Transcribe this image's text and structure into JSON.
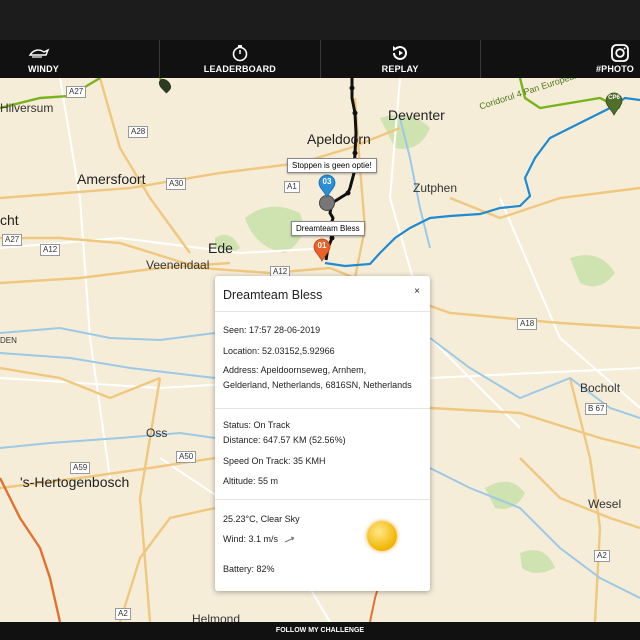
{
  "nav": {
    "items": [
      {
        "label": "WINDY",
        "icon": "windy-icon"
      },
      {
        "label": "LEADERBOARD",
        "icon": "stopwatch-icon"
      },
      {
        "label": "REPLAY",
        "icon": "replay-icon"
      },
      {
        "label": "#PHOTO",
        "icon": "instagram-icon"
      }
    ]
  },
  "map": {
    "places": {
      "hilversum": "Hilversum",
      "apeldoorn": "Apeldoorn",
      "deventer": "Deventer",
      "amersfoort": "Amersfoort",
      "zutphen": "Zutphen",
      "ede": "Ede",
      "veenendaal": "Veenendaal",
      "oss": "Oss",
      "hertogenbosch": "'s-Hertogenbosch",
      "bocholt": "Bocholt",
      "wesel": "Wesel",
      "helmond": "Helmond",
      "utrecht_fragment": "cht",
      "den_fragment": "DEN"
    },
    "roads": [
      "A27",
      "A28",
      "A1",
      "A30",
      "A12",
      "A27",
      "A12",
      "A18",
      "A50",
      "A2",
      "A59",
      "B 67",
      "A2"
    ],
    "route_label": "Coridorul 4 Pan European",
    "tooltips": {
      "stop": "Stoppen is geen optie!",
      "team": "Dreamteam Bless"
    },
    "pins": {
      "blue": "03",
      "orange": "01",
      "green": "CP6"
    }
  },
  "popup": {
    "title": "Dreamteam Bless",
    "close": "×",
    "seen": "Seen: 17:57 28-06-2019",
    "location": "Location: 52.03152,5.92966",
    "address_line1": "Address: Apeldoornseweg, Arnhem,",
    "address_line2": "Gelderland, Netherlands, 6816SN, Netherlands",
    "status": "Status: On Track",
    "distance": "Distance: 647.57 KM (52.56%)",
    "speed": "Speed On Track: 35 KMH",
    "altitude": "Altitude: 55 m",
    "weather": "25.23°C, Clear Sky",
    "wind": "Wind: 3.1 m/s",
    "battery": "Battery: 82%",
    "weather_icon": "sun-icon"
  },
  "footer": {
    "label": "FOLLOW MY CHALLENGE"
  },
  "colors": {
    "nav_bg": "#111111",
    "map_bg": "#f6edd9",
    "route_green": "#78b31e",
    "river_blue": "#2b93d6",
    "pin_blue": "#2a8fd6",
    "pin_orange": "#e8622a",
    "track": "#111111"
  }
}
